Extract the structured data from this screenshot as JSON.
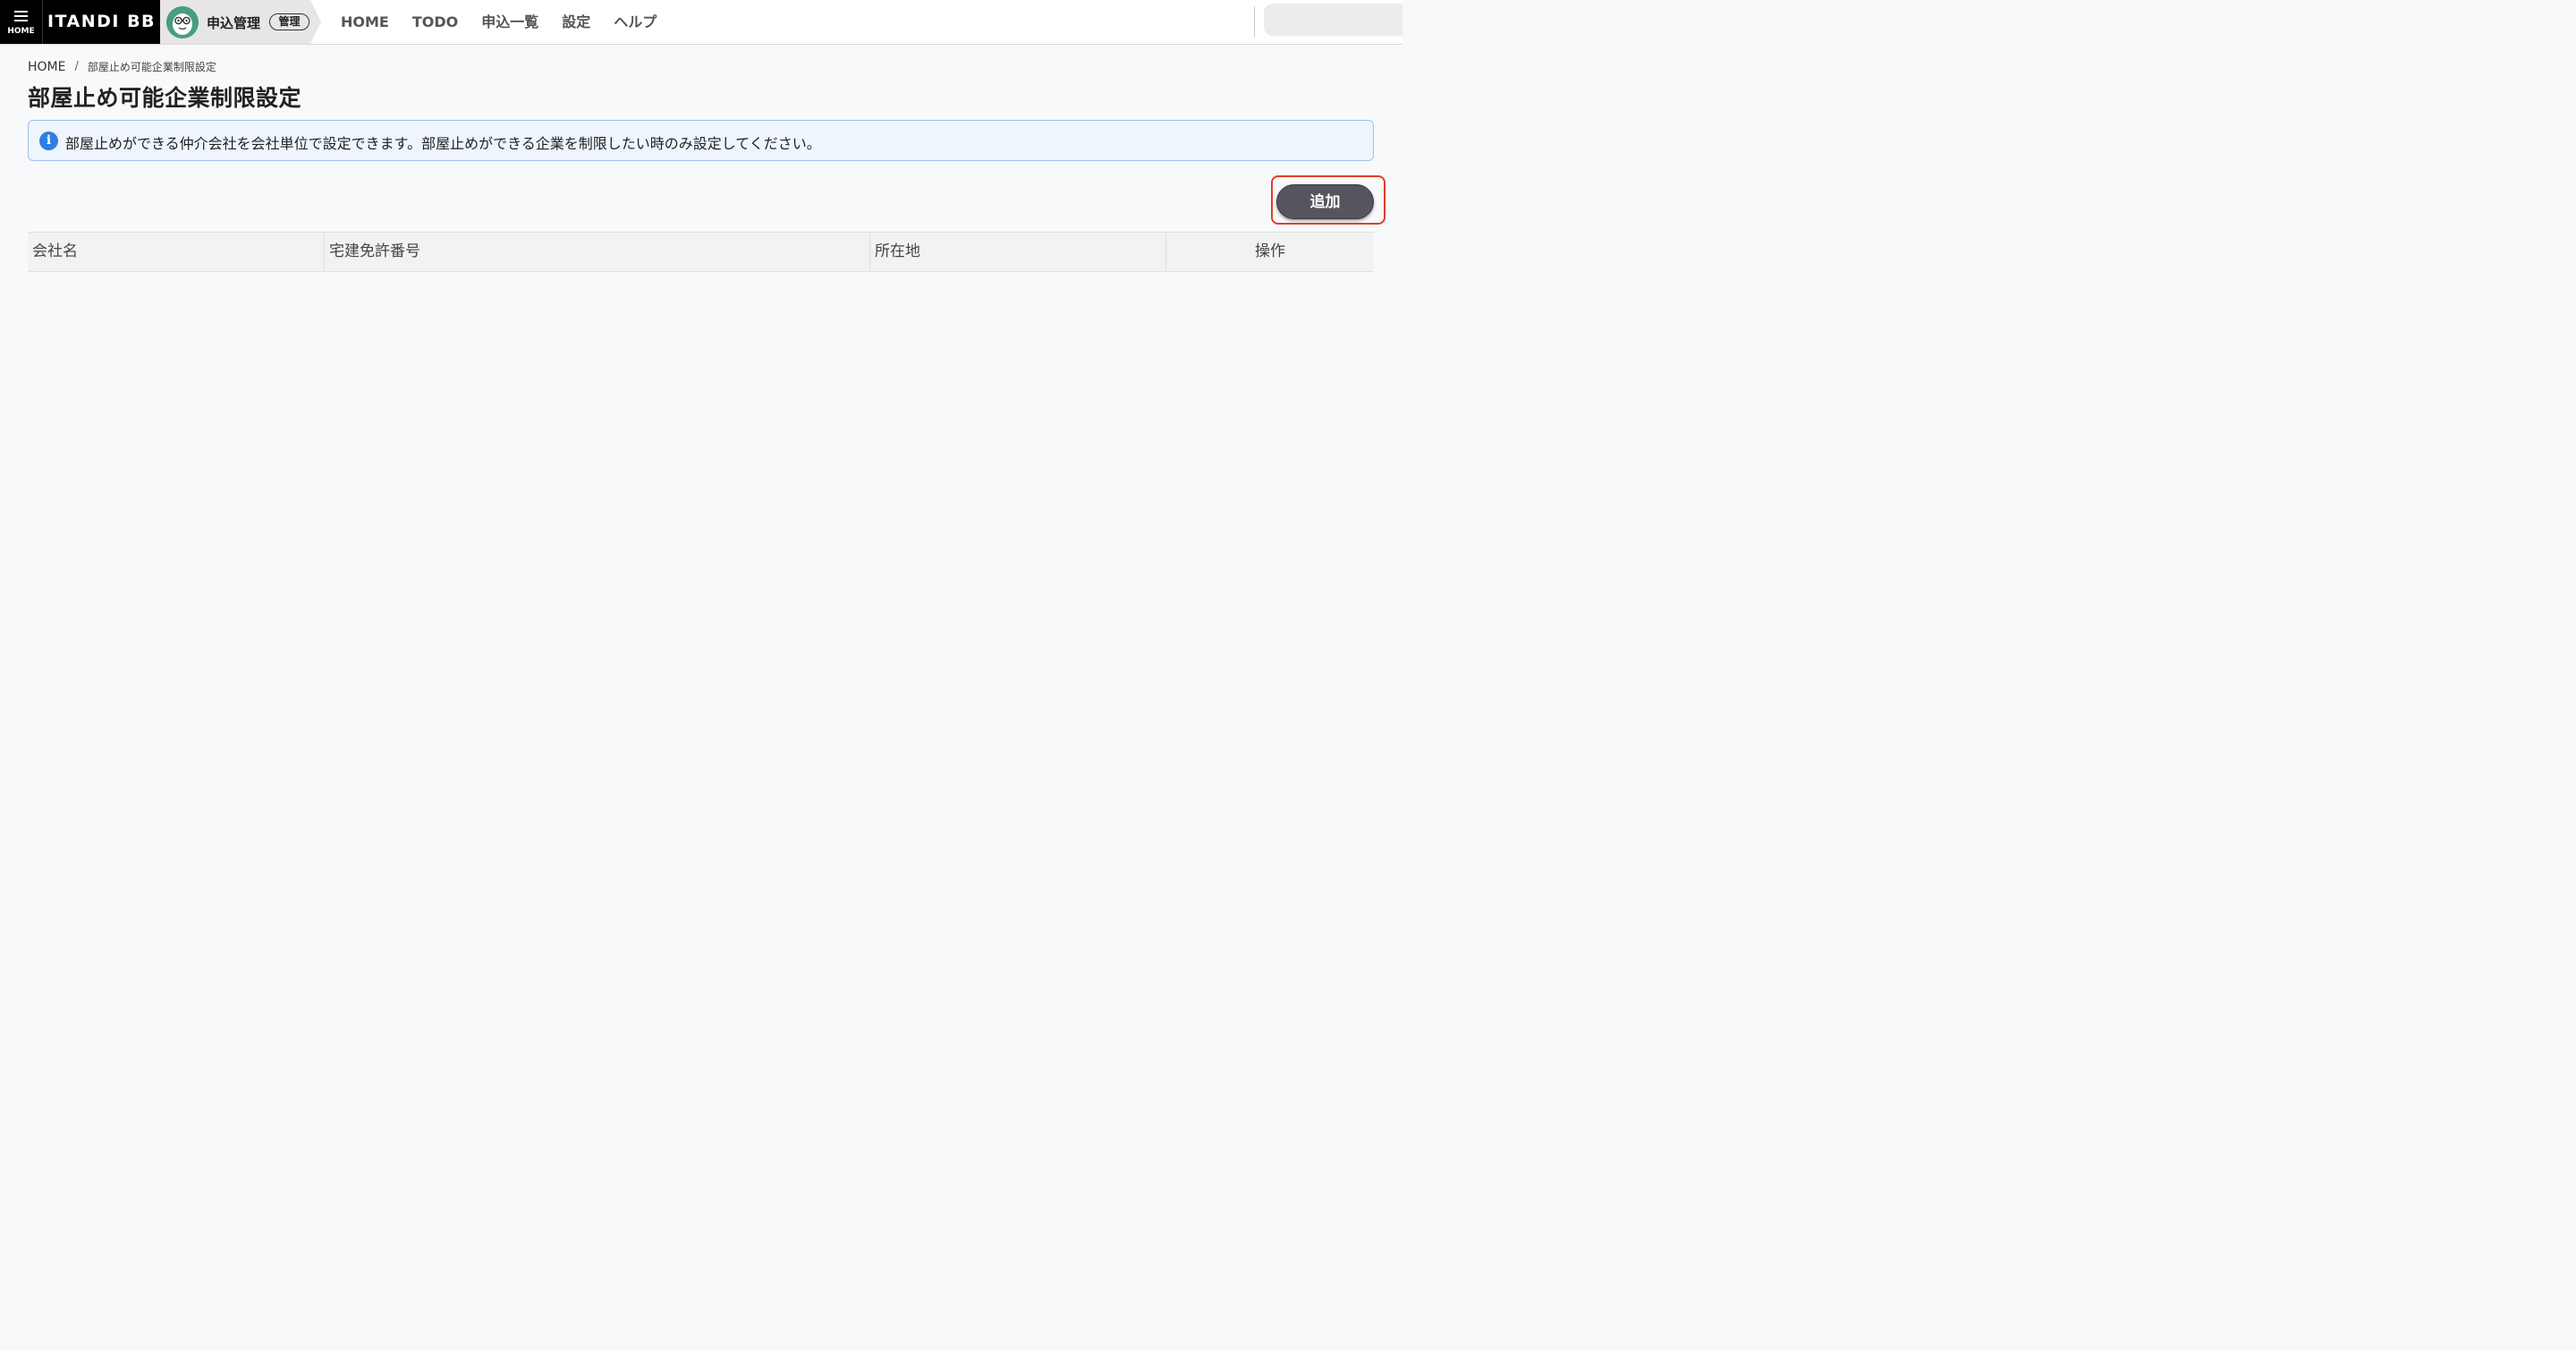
{
  "header": {
    "menu_label": "HOME",
    "logo": "ITANDI BB",
    "app_name": "申込管理",
    "app_badge": "管理",
    "nav": [
      "HOME",
      "TODO",
      "申込一覧",
      "設定",
      "ヘルプ"
    ]
  },
  "breadcrumb": {
    "home": "HOME",
    "separator": "/",
    "current": "部屋止め可能企業制限設定"
  },
  "page": {
    "title": "部屋止め可能企業制限設定",
    "info_icon": "info-icon",
    "info_text": "部屋止めができる仲介会社を会社単位で設定できます。部屋止めができる企業を制限したい時のみ設定してください。",
    "add_button": "追加"
  },
  "table": {
    "headers": [
      "会社名",
      "宅建免許番号",
      "所在地",
      "操作"
    ],
    "rows": []
  },
  "colors": {
    "accent_button": "#56555e",
    "info_bg": "#eef5fd",
    "info_border": "#9cc3ea",
    "highlight_frame": "#e0402a"
  }
}
